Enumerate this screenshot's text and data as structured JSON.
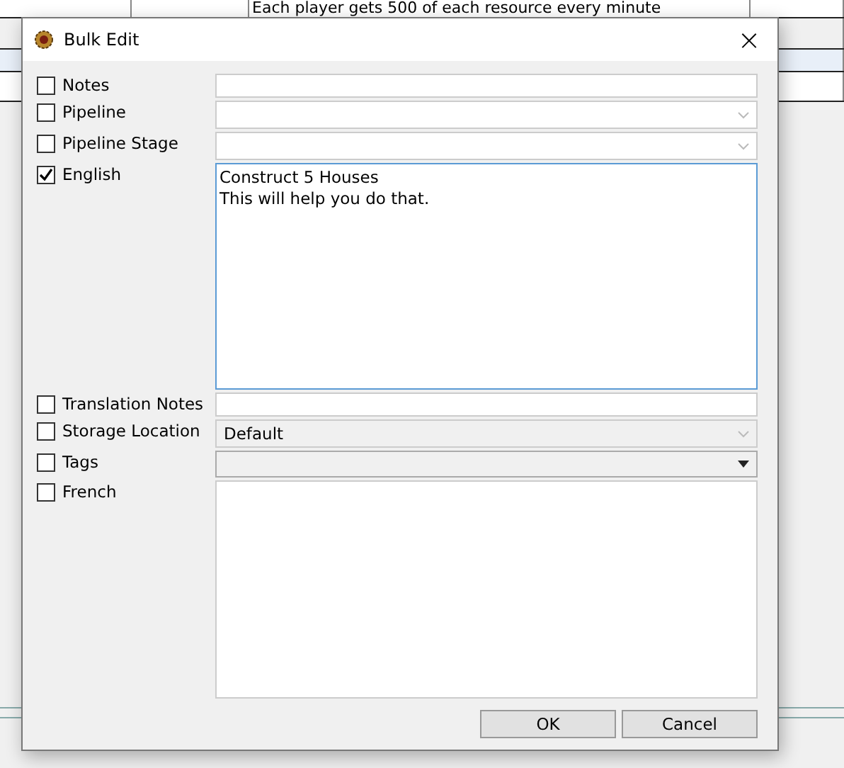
{
  "background_table": {
    "visible_cell": "Each player gets 500 of each resource every minute"
  },
  "dialog": {
    "title": "Bulk Edit",
    "close": "×",
    "rows": [
      {
        "label": "Notes",
        "checked": false,
        "kind": "text",
        "value": ""
      },
      {
        "label": "Pipeline",
        "checked": false,
        "kind": "combo",
        "value": ""
      },
      {
        "label": "Pipeline Stage",
        "checked": false,
        "kind": "combo",
        "value": ""
      },
      {
        "label": "English",
        "checked": true,
        "kind": "textarea",
        "value": "Construct 5 Houses\nThis will help you do that."
      },
      {
        "label": "Translation Notes",
        "checked": false,
        "kind": "text",
        "value": ""
      },
      {
        "label": "Storage Location",
        "checked": false,
        "kind": "combo-disabled",
        "value": "Default"
      },
      {
        "label": "Tags",
        "checked": false,
        "kind": "dropdown",
        "value": ""
      },
      {
        "label": "French",
        "checked": false,
        "kind": "textarea",
        "value": ""
      }
    ],
    "buttons": [
      "OK",
      "Cancel"
    ]
  }
}
